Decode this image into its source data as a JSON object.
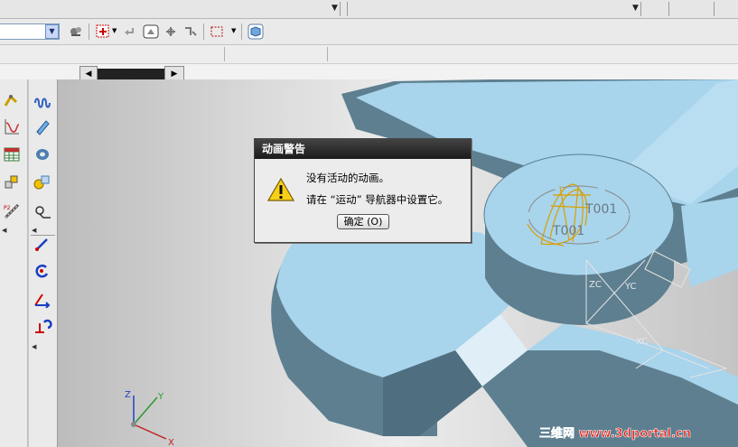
{
  "dialog": {
    "title": "动画警告",
    "message_line1": "没有活动的动画。",
    "message_line2": "请在 “运动” 导航器中设置它。",
    "ok_label": "确定 (O)",
    "icon": "warning-icon"
  },
  "viewport": {
    "part_label_1": "T001",
    "part_label_2": "T001",
    "csys_label_zc": "ZC",
    "csys_label_yc": "YC",
    "csys_label_xc": "XC",
    "triad_x": "X",
    "triad_y": "Y",
    "triad_z": "Z"
  },
  "watermark": {
    "text": "三维网 www.3dportal.cn",
    "color": "#e3261e"
  },
  "toolbar_icons": [
    "color-palette-icon",
    "snap-point-icon",
    "undo-icon",
    "fit-view-icon",
    "rotate-icon",
    "pan-icon",
    "selection-box-icon",
    "shaded-cube-icon"
  ],
  "palette_icons": [
    "link-icon",
    "graph-icon",
    "spreadsheet-icon",
    "joint-icon",
    "mechanism-icon",
    "spring-icon",
    "marker-icon",
    "bushing-icon",
    "contact-icon",
    "motion-icon",
    "force-icon",
    "rotation-icon",
    "vector-force-icon",
    "torque-icon"
  ],
  "colors": {
    "part_face": "#a8d4ec",
    "part_side": "#5d7f90",
    "dialog_title_bg": "#1a1a1a"
  }
}
